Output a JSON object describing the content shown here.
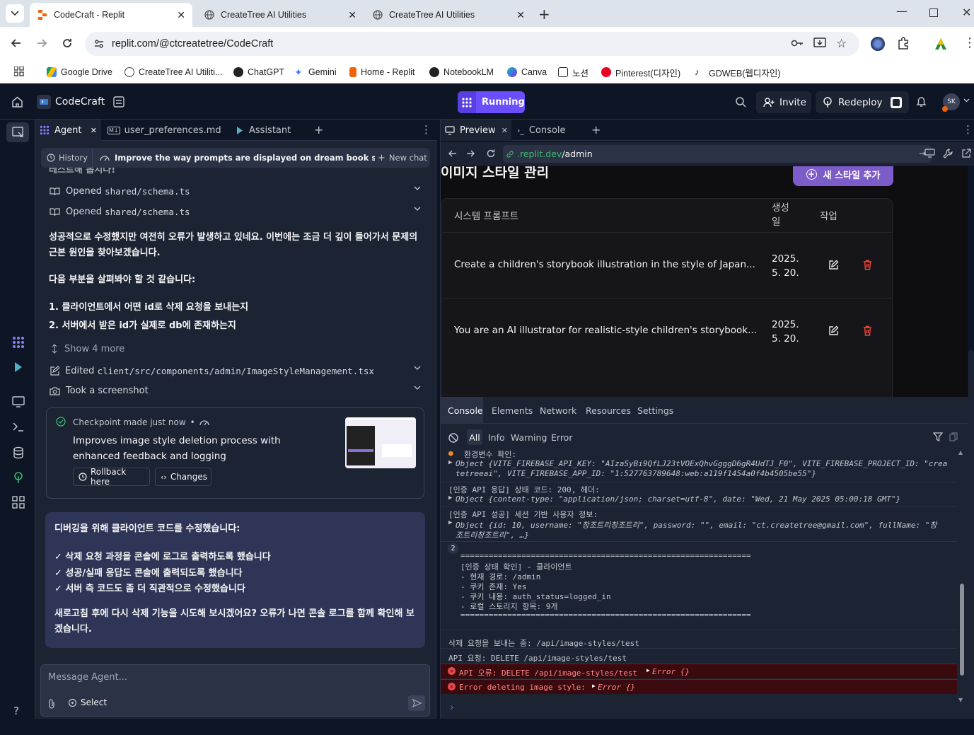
{
  "browser": {
    "tabs": [
      {
        "title": "CodeCraft - Replit",
        "active": true
      },
      {
        "title": "CreateTree AI Utilities",
        "active": false
      },
      {
        "title": "CreateTree AI Utilities",
        "active": false
      }
    ],
    "url": "replit.com/@ctcreatetree/CodeCraft",
    "bookmarks": [
      "Google Drive",
      "CreateTree AI Utiliti...",
      "ChatGPT",
      "Gemini",
      "Home - Replit",
      "NotebookLM",
      "Canva",
      "노션",
      "Pinterest(디자인)",
      "GDWEB(웹디자인)"
    ]
  },
  "replit": {
    "project_name": "CodeCraft",
    "run_label": "Running",
    "invite_label": "Invite",
    "redeploy_label": "Redeploy",
    "avatar_initials": "SK",
    "accent_color": "#6b4eff"
  },
  "left_panel": {
    "tabs": [
      "Agent",
      "user_preferences.md",
      "Assistant"
    ],
    "history_label": "History",
    "chat_title": "Improve the way prompts are displayed on dream book scene pa...",
    "new_chat_label": "New chat",
    "cut_text": "테스트해 봅시다!",
    "actions": [
      {
        "prefix": "Opened",
        "path": "shared/schema.ts"
      },
      {
        "prefix": "Opened",
        "path": "shared/schema.ts"
      }
    ],
    "message1": "성공적으로 수정했지만 여전히 오류가 발생하고 있네요. 이번에는 조금 더 깊이 들어가서 문제의 근본 원인을 찾아보겠습니다.",
    "message2": "다음 부분을 살펴봐야 할 것 같습니다:",
    "list": [
      "1. 클라이언트에서 어떤 id로 삭제 요청을 보내는지",
      "2. 서버에서 받은 id가 실제로 db에 존재하는지"
    ],
    "show_more": "Show 4 more",
    "edited": {
      "prefix": "Edited",
      "path": "client/src/components/admin/ImageStyleManagement.tsx"
    },
    "screenshot": "Took a screenshot",
    "checkpoint": {
      "header": "Checkpoint made just now",
      "title": "Improves image style deletion process with enhanced feedback and logging",
      "rollback": "Rollback here",
      "changes": "Changes"
    },
    "agent_message": {
      "intro": "디버깅을 위해 클라이언트 코드를 수정했습니다:",
      "items": [
        "✓ 삭제 요청 과정을 콘솔에 로그로 출력하도록 했습니다",
        "✓ 성공/실패 응답도 콘솔에 출력되도록 했습니다",
        "✓ 서버 측 코드도 좀 더 직관적으로 수정했습니다"
      ],
      "outro": "새로고침 후에 다시 삭제 기능을 시도해 보시겠어요? 오류가 나면 콘솔 로그를 함께 확인해 보겠습니다."
    },
    "input_placeholder": "Message Agent...",
    "select_label": "Select"
  },
  "right_panel": {
    "tabs": [
      "Preview",
      "Console"
    ],
    "preview_url_host": ".replit.dev",
    "preview_url_path": "/admin",
    "site": {
      "heading": "이미지 스타일 관리",
      "add_button": "새 스타일 추가",
      "col_prompt": "시스템 프롬프트",
      "col_date": "생성일",
      "col_action": "작업",
      "rows": [
        {
          "prompt": "Create a children's storybook illustration in the style of Japan...",
          "date": "2025. 5. 20."
        },
        {
          "prompt": "You are an AI illustrator for realistic-style children's storybook...",
          "date": "2025. 5. 20."
        }
      ]
    },
    "devtools": {
      "tabs": [
        "Console",
        "Elements",
        "Network",
        "Resources",
        "Settings"
      ],
      "levels": [
        "All",
        "Info",
        "Warning",
        "Error"
      ],
      "logs": {
        "env_check": "환경변수 확인:",
        "env_obj_a": "Object {VITE_FIREBASE_API_KEY: \"AIzaSyBi9QfLJ23tVOExQhvGgggD6gR4UdTJ_F0\", VITE_FIREBASE_PROJECT_ID: \"crea",
        "env_obj_b": "tetreeai\", VITE_FIREBASE_APP_ID: \"1:527763789648:web:a119f1454a0f4b4505be55\"}",
        "auth_resp": "[인증 API 응답] 상태 코드: 200, 헤더:",
        "auth_resp_obj": "Object {content-type: \"application/json; charset=utf-8\", date: \"Wed, 21 May 2025 05:00:18 GMT\"}",
        "auth_ok": "[인증 API 성공] 세션 기반 사용자 정보:",
        "auth_ok_obj_a": "Object {id: 10, username: \"창조트리창조트리\", password: \"\", email: \"ct.createtree@gmail.com\", fullName: \"창",
        "auth_ok_obj_b": "조트리창조트리\", …}",
        "count": "2",
        "sep": "==============================================================",
        "status_title": "[인증 상태 확인] - 클라이언트",
        "status_lines": [
          "- 현재 경로: /admin",
          "- 쿠키 존재: Yes",
          "- 쿠키 내용: auth_status=logged_in",
          "- 로컬 스토리지 항목: 9개"
        ],
        "delete_req": "삭제 요청을 보내는 중: /api/image-styles/test",
        "api_req": "API 요청: DELETE /api/image-styles/test",
        "err1": "API 오류: DELETE /api/image-styles/test",
        "err1_obj": "Error {}",
        "err2": "Error deleting image style:",
        "err2_obj": "Error {}"
      }
    }
  }
}
